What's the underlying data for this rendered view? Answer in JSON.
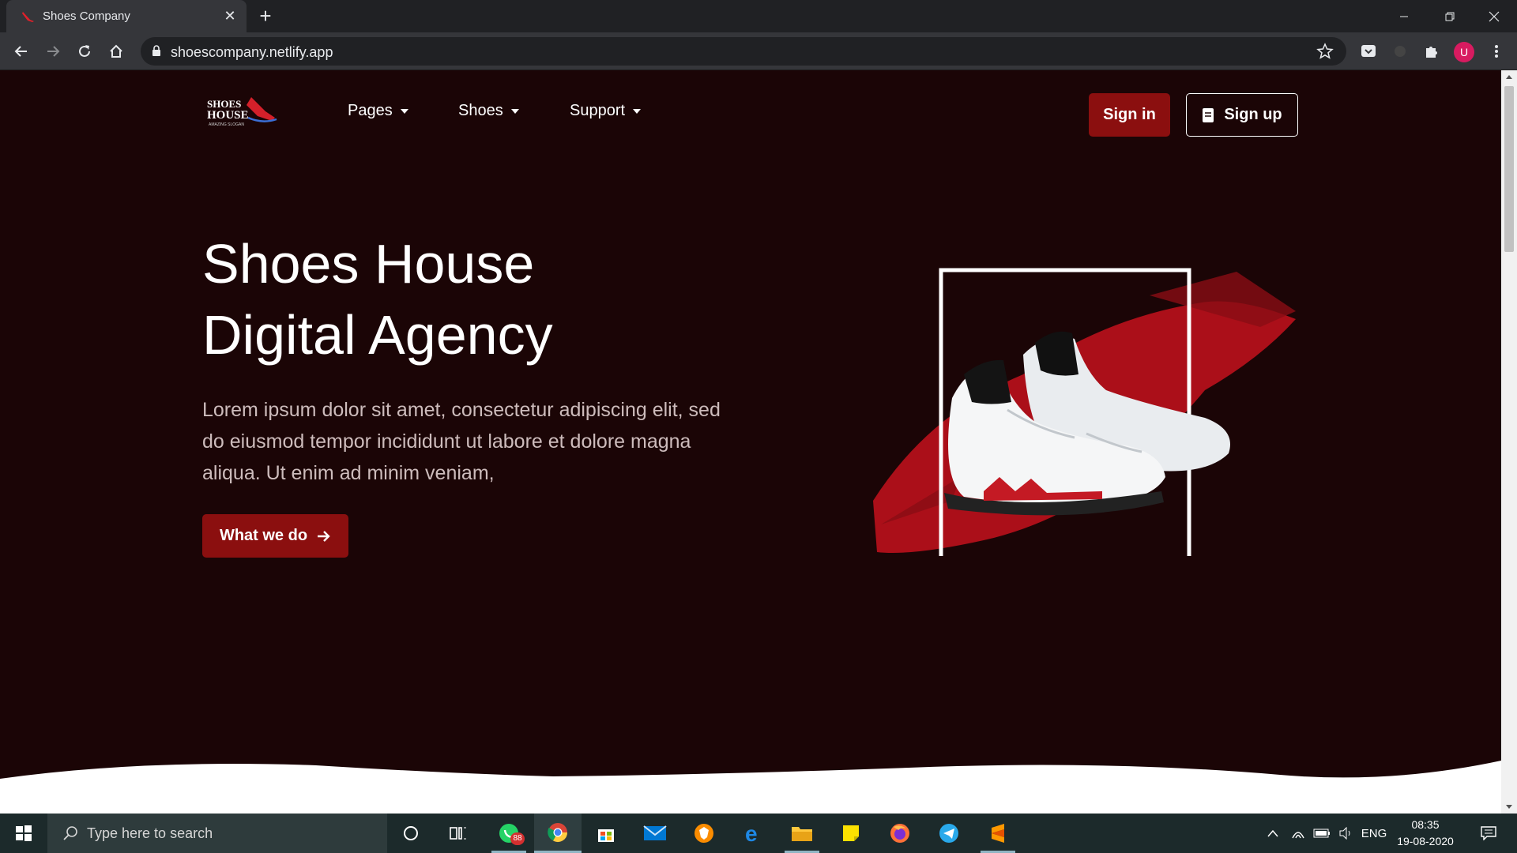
{
  "browser": {
    "tab_title": "Shoes Company",
    "url": "shoescompany.netlify.app",
    "profile_initial": "U"
  },
  "site": {
    "logo_text_top": "SHOES",
    "logo_text_mid": "HOUSE",
    "logo_text_bottom": "AMAZING SLOGAN",
    "nav": [
      {
        "label": "Pages"
      },
      {
        "label": "Shoes"
      },
      {
        "label": "Support"
      }
    ],
    "signin_label": "Sign in",
    "signup_label": "Sign up",
    "hero_title_line1": "Shoes House",
    "hero_title_line2": "Digital Agency",
    "hero_text": "Lorem ipsum dolor sit amet, consectetur adipiscing elit, sed do eiusmod tempor incididunt ut labore et dolore magna aliqua. Ut enim ad minim veniam,",
    "cta_label": "What we do",
    "colors": {
      "background": "#1b0506",
      "accent": "#8b0f0f",
      "text": "#ffffff"
    }
  },
  "taskbar": {
    "search_placeholder": "Type here to search",
    "whatsapp_badge": "88",
    "language": "ENG",
    "time": "08:35",
    "date": "19-08-2020",
    "apps": [
      "cortana-icon",
      "task-view-icon",
      "whatsapp-icon",
      "chrome-icon",
      "store-icon",
      "mail-icon",
      "brave-icon",
      "edge-icon",
      "file-explorer-icon",
      "sticky-notes-icon",
      "firefox-icon",
      "telegram-icon",
      "sublime-text-icon"
    ]
  }
}
